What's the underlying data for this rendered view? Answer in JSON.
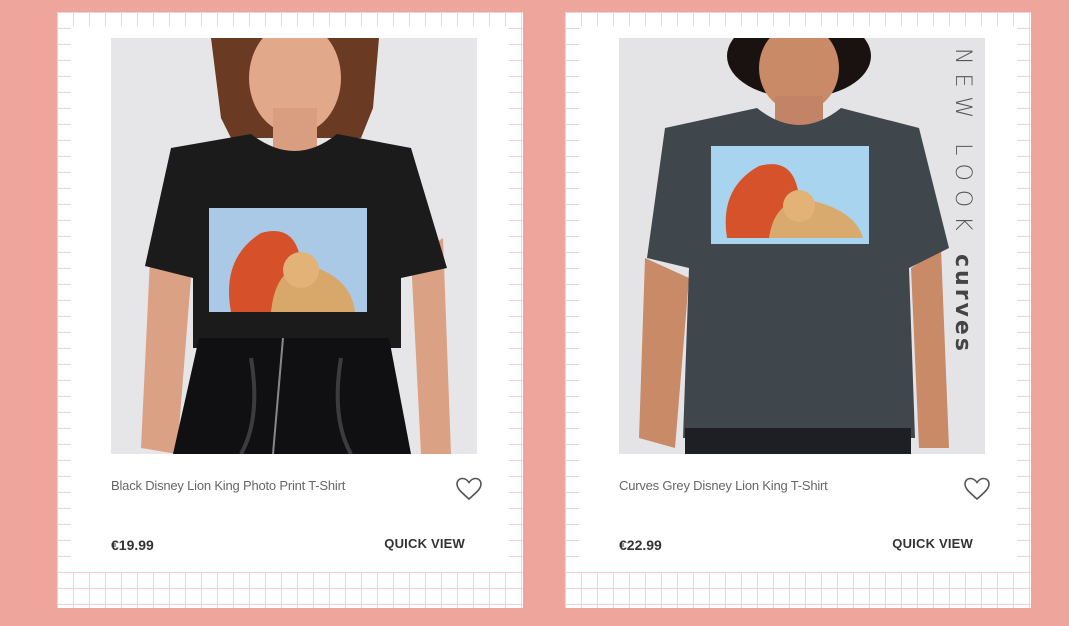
{
  "products": [
    {
      "name": "Black Disney Lion King Photo Print T-Shirt",
      "price": "€19.99",
      "quick_view_label": "QUICK VIEW",
      "wishlist_icon": "heart-icon",
      "tshirt_color": "#1b1b1c"
    },
    {
      "name": "Curves Grey Disney Lion King T-Shirt",
      "price": "€22.99",
      "quick_view_label": "QUICK VIEW",
      "wishlist_icon": "heart-icon",
      "tshirt_color": "#3f474d",
      "brand_label_light": "NEW LOOK",
      "brand_label_bold": "curves"
    }
  ],
  "colors": {
    "background": "#eea59c",
    "grid_line": "#f4cfd3",
    "card": "#ffffff"
  }
}
